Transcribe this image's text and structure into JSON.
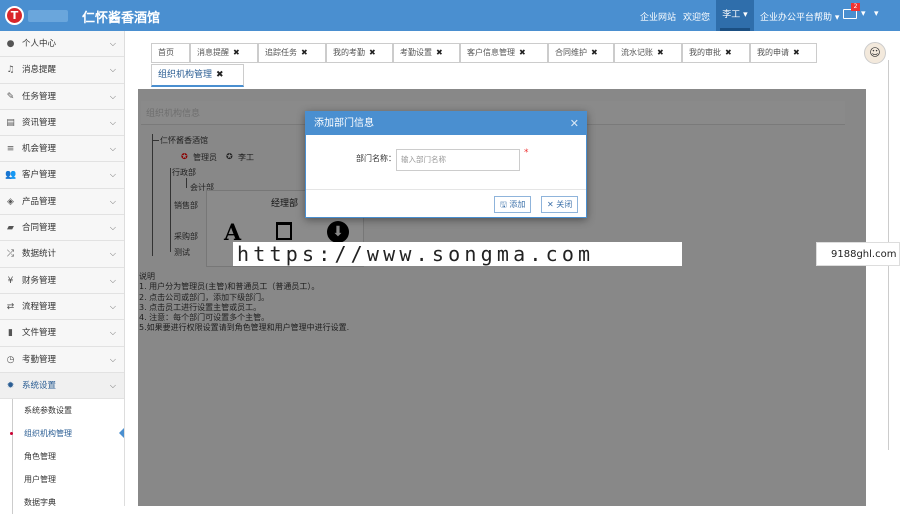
{
  "app": {
    "logo_letter": "T",
    "title": "仁怀酱香酒馆"
  },
  "topbar": {
    "links": [
      "企业网站",
      "欢迎您",
      "李工",
      "企业办公平台帮助"
    ],
    "mail_badge": "2",
    "colors": {
      "bar": "#4a8fd0",
      "active": "#2f6eab"
    }
  },
  "sidebar": {
    "items": [
      {
        "label": "个人中心",
        "icon": "user-icon"
      },
      {
        "label": "消息提醒",
        "icon": "bell-icon"
      },
      {
        "label": "任务管理",
        "icon": "edit-icon"
      },
      {
        "label": "资讯管理",
        "icon": "news-icon"
      },
      {
        "label": "机会管理",
        "icon": "list-icon"
      },
      {
        "label": "客户管理",
        "icon": "users-icon"
      },
      {
        "label": "产品管理",
        "icon": "box-icon"
      },
      {
        "label": "合同管理",
        "icon": "folder-icon"
      },
      {
        "label": "数据统计",
        "icon": "shuffle-icon"
      },
      {
        "label": "财务管理",
        "icon": "yen-icon"
      },
      {
        "label": "流程管理",
        "icon": "retweet-icon"
      },
      {
        "label": "文件管理",
        "icon": "file-icon"
      },
      {
        "label": "考勤管理",
        "icon": "clock-icon"
      },
      {
        "label": "系统设置",
        "icon": "gear-icon"
      }
    ],
    "subitems": [
      "系统参数设置",
      "组织机构管理",
      "角色管理",
      "用户管理",
      "数据字典"
    ]
  },
  "tabs": [
    "首页",
    "消息提醒",
    "追踪任务",
    "我的考勤",
    "考勤设置",
    "客户信息管理",
    "合同维护",
    "流水记账",
    "我的审批",
    "我的申请",
    "组织机构管理"
  ],
  "panel": {
    "title": "组织机构信息"
  },
  "tree": {
    "root": "仁怀酱香酒馆",
    "roles": [
      "管理员",
      "李工"
    ],
    "nodes": [
      "行政部",
      "会计部",
      "销售部",
      "采购部",
      "测试"
    ]
  },
  "popover": {
    "title": "经理部"
  },
  "notes": {
    "title": "说明",
    "lines": [
      "1. 用户分为管理员(主管)和普通员工（普通员工）。",
      "2. 点击公司或部门，添加下级部门。",
      "3. 点击员工进行设置主管或员工。",
      "4. 注意：每个部门可设置多个主管。",
      "5.如果要进行权限设置请到角色管理和用户管理中进行设置."
    ]
  },
  "watermark": {
    "text": "https://www.songma.com",
    "side": "9188ghl.com"
  },
  "modal": {
    "title": "添加部门信息",
    "label": "部门名称：",
    "placeholder": "输入部门名称",
    "required": "*",
    "add": "添加",
    "close": "关闭"
  }
}
